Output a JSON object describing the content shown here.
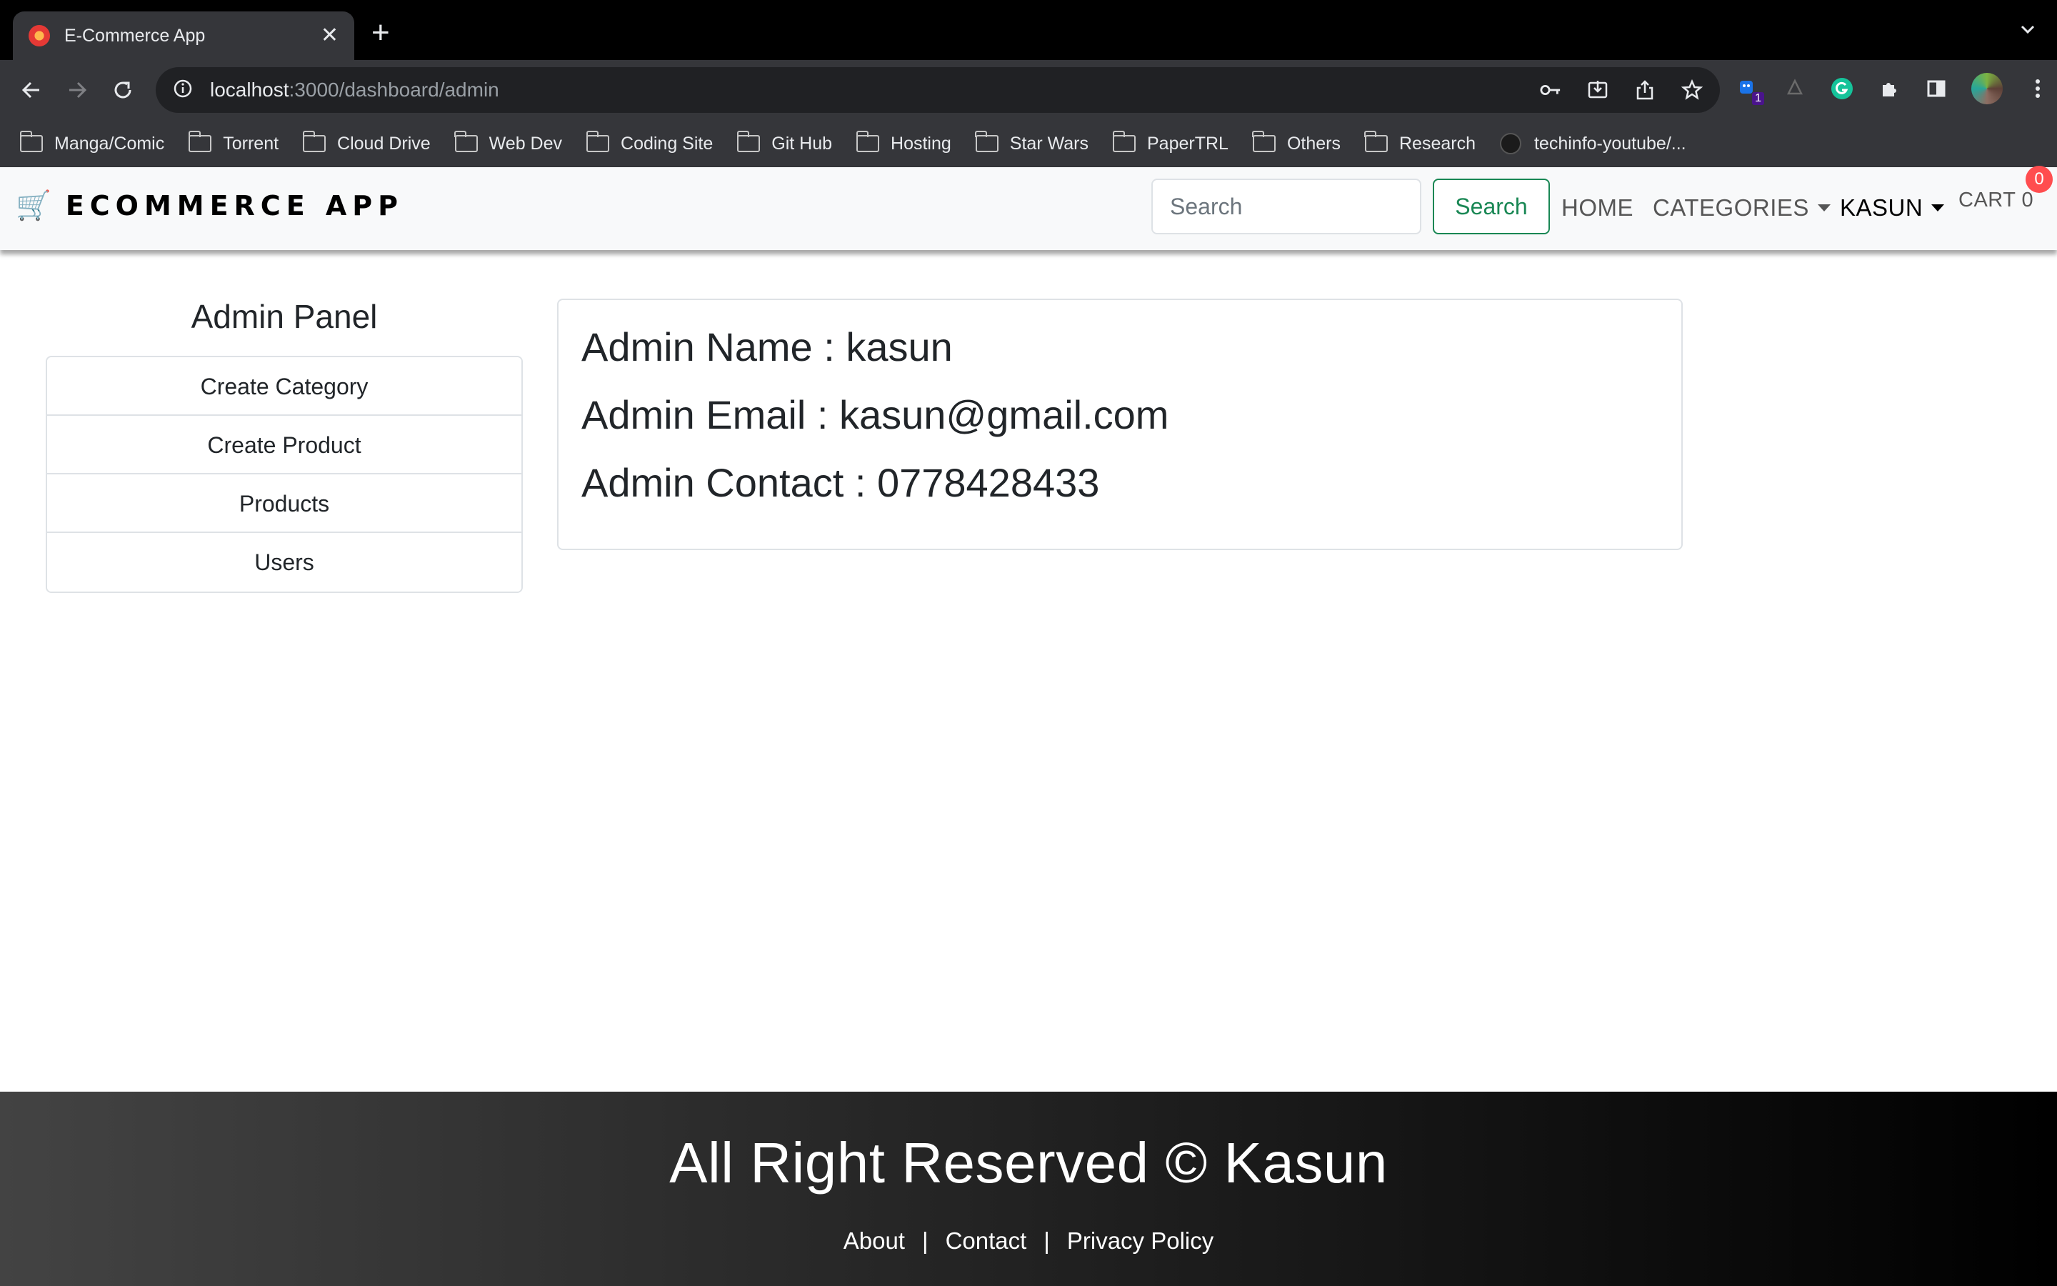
{
  "browser": {
    "tab_title": "E-Commerce App",
    "url_host": "localhost",
    "url_path": ":3000/dashboard/admin",
    "extension_badge": "1",
    "bookmarks": [
      {
        "label": "Manga/Comic",
        "icon": "folder-icon"
      },
      {
        "label": "Torrent",
        "icon": "folder-icon"
      },
      {
        "label": "Cloud Drive",
        "icon": "folder-icon"
      },
      {
        "label": "Web Dev",
        "icon": "folder-icon"
      },
      {
        "label": "Coding Site",
        "icon": "folder-icon"
      },
      {
        "label": "Git Hub",
        "icon": "folder-icon"
      },
      {
        "label": "Hosting",
        "icon": "folder-icon"
      },
      {
        "label": "Star Wars",
        "icon": "folder-icon"
      },
      {
        "label": "PaperTRL",
        "icon": "folder-icon"
      },
      {
        "label": "Others",
        "icon": "folder-icon"
      },
      {
        "label": "Research",
        "icon": "folder-icon"
      },
      {
        "label": "techinfo-youtube/...",
        "icon": "github-icon"
      }
    ]
  },
  "navbar": {
    "brand_icon": "🛒",
    "brand_text": "ECOMMERCE APP",
    "search_placeholder": "Search",
    "search_button": "Search",
    "home": "HOME",
    "categories": "CATEGORIES",
    "user": "KASUN",
    "cart": "CART 0",
    "cart_badge": "0",
    "accent_color": "#198754"
  },
  "sidebar": {
    "title": "Admin Panel",
    "items": [
      {
        "label": "Create Category"
      },
      {
        "label": "Create Product"
      },
      {
        "label": "Products"
      },
      {
        "label": "Users"
      }
    ]
  },
  "admin": {
    "name": "Admin Name : kasun",
    "email": "Admin Email : kasun@gmail.com",
    "contact": "Admin Contact : 0778428433"
  },
  "footer": {
    "title": "All Right Reserved © Kasun",
    "links": [
      "About",
      "Contact",
      "Privacy Policy"
    ],
    "separator": "|"
  }
}
